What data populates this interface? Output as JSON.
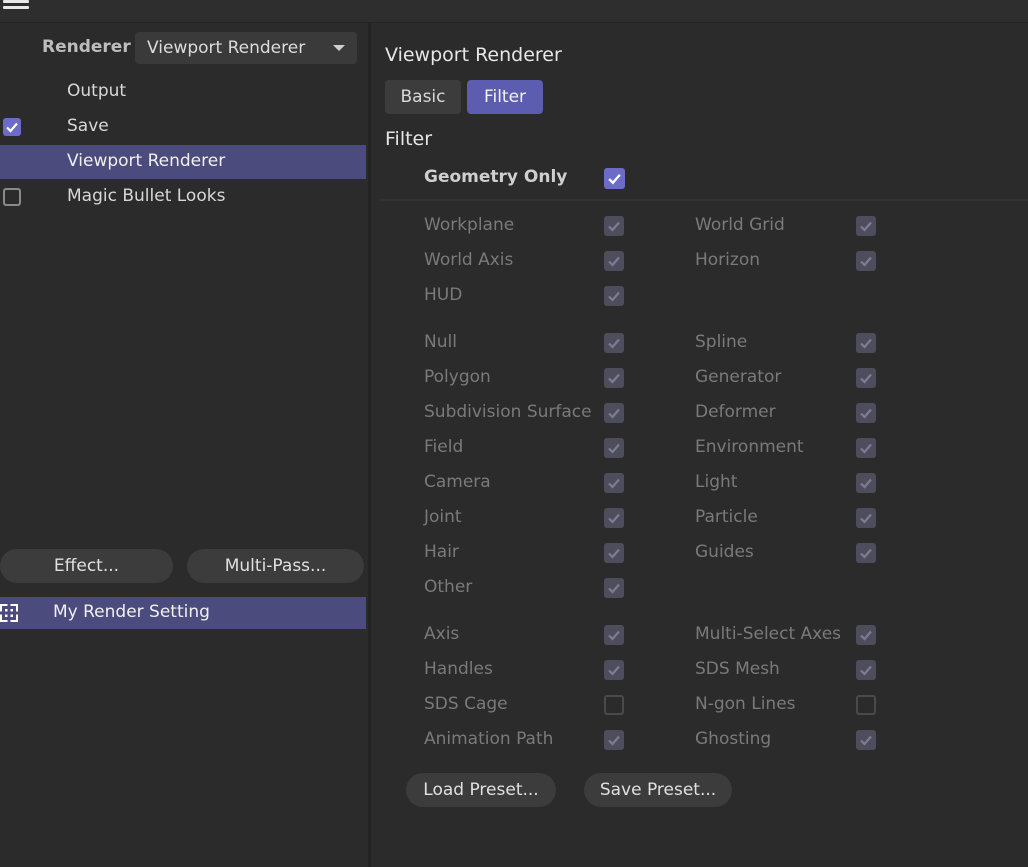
{
  "renderer": {
    "label": "Renderer",
    "selected": "Viewport Renderer"
  },
  "list_items": [
    {
      "label": "Output",
      "check": "none"
    },
    {
      "label": "Save",
      "check": "on"
    },
    {
      "label": "Viewport Renderer",
      "check": "none",
      "selected": true
    },
    {
      "label": "Magic Bullet Looks",
      "check": "off"
    }
  ],
  "buttons": {
    "effect": "Effect...",
    "multipass": "Multi-Pass...",
    "load_preset": "Load Preset...",
    "save_preset": "Save Preset..."
  },
  "render_setting": {
    "label": "My Render Setting"
  },
  "panel": {
    "title": "Viewport Renderer",
    "tabs": [
      "Basic",
      "Filter"
    ],
    "active_tab": "Filter",
    "section": "Filter",
    "geometry_only": {
      "label": "Geometry Only",
      "checked": true
    }
  },
  "filter_groups": [
    [
      [
        {
          "label": "Workplane",
          "checked": true
        },
        {
          "label": "World Grid",
          "checked": true
        }
      ],
      [
        {
          "label": "World Axis",
          "checked": true
        },
        {
          "label": "Horizon",
          "checked": true
        }
      ],
      [
        {
          "label": "HUD",
          "checked": true
        },
        null
      ]
    ],
    [
      [
        {
          "label": "Null",
          "checked": true
        },
        {
          "label": "Spline",
          "checked": true
        }
      ],
      [
        {
          "label": "Polygon",
          "checked": true
        },
        {
          "label": "Generator",
          "checked": true
        }
      ],
      [
        {
          "label": "Subdivision Surface",
          "checked": true
        },
        {
          "label": "Deformer",
          "checked": true
        }
      ],
      [
        {
          "label": "Field",
          "checked": true
        },
        {
          "label": "Environment",
          "checked": true
        }
      ],
      [
        {
          "label": "Camera",
          "checked": true
        },
        {
          "label": "Light",
          "checked": true
        }
      ],
      [
        {
          "label": "Joint",
          "checked": true
        },
        {
          "label": "Particle",
          "checked": true
        }
      ],
      [
        {
          "label": "Hair",
          "checked": true
        },
        {
          "label": "Guides",
          "checked": true
        }
      ],
      [
        {
          "label": "Other",
          "checked": true
        },
        null
      ]
    ],
    [
      [
        {
          "label": "Axis",
          "checked": true
        },
        {
          "label": "Multi-Select Axes",
          "checked": true
        }
      ],
      [
        {
          "label": "Handles",
          "checked": true
        },
        {
          "label": "SDS Mesh",
          "checked": true
        }
      ],
      [
        {
          "label": "SDS Cage",
          "checked": false
        },
        {
          "label": "N-gon Lines",
          "checked": false
        }
      ],
      [
        {
          "label": "Animation Path",
          "checked": true
        },
        {
          "label": "Ghosting",
          "checked": true
        }
      ]
    ]
  ],
  "colors": {
    "accent": "#6c6cc8",
    "selection": "#4b4b7d",
    "panel_bg": "#2b2b2b"
  }
}
